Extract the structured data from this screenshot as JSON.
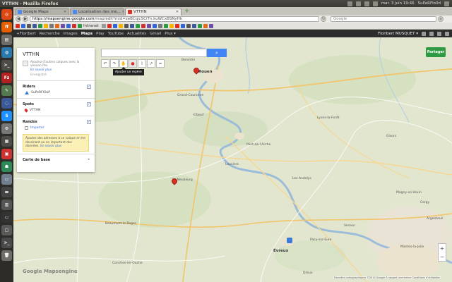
{
  "topbar": {
    "window_title": "VTTHN - Mozilla Firefox",
    "clock": "mar. 3 juin 19:46",
    "user": "SuPeRFlo0d"
  },
  "browser": {
    "tabs": [
      {
        "label": "Google Maps",
        "favicon_color": "#4a8af4",
        "active": false
      },
      {
        "label": "Localisation des me...",
        "favicon_color": "#4a8af4",
        "active": false
      },
      {
        "label": "VTTHN",
        "favicon_color": "#d93025",
        "active": true
      }
    ],
    "new_tab_icon": "+",
    "url_host": "https://mapsengine.google.com",
    "url_rest": "/map/edit?mid=zeBCqjcSCiTn.kuWCxBSNyHk",
    "search_placeholder": "Google"
  },
  "bookmarks": {
    "intranet_label": "Intranet",
    "icon_colors": [
      "#d93025",
      "#3367d6",
      "#5a5a5a",
      "#3b5998",
      "#2e9a44",
      "#f4b400",
      "#777777",
      "#e06c1f",
      "#6d4fa8",
      "#3367d6",
      "#c33",
      "#2e9a44",
      "#999",
      "#d93025",
      "#3367d6",
      "#f4b400",
      "#555",
      "#3b5998",
      "#2e9a44",
      "#c33",
      "#6d4fa8",
      "#3367d6",
      "#777777",
      "#2e9a44",
      "#f4b400",
      "#d93025",
      "#3367d6",
      "#555",
      "#3b5998",
      "#2e9a44",
      "#e06c1f",
      "#6d4fa8"
    ]
  },
  "google_bar": {
    "items": [
      "+Floribert",
      "Recherche",
      "Images",
      "Maps",
      "Play",
      "YouTube",
      "Actualités",
      "Gmail",
      "Plus ▾"
    ],
    "active_index": 3,
    "user_name": "Floribert MUSQUET ▾"
  },
  "panel": {
    "title": "VTTHN",
    "info_text": "Ajoutez d'autres calques avec la version Pro.",
    "info_link": "En savoir plus",
    "saved_text": "Enregistré",
    "layers": [
      {
        "name": "Riders",
        "checked": true,
        "items": [
          {
            "label": "SuPeRFlOoP",
            "marker": "tri"
          }
        ]
      },
      {
        "name": "Spots",
        "checked": true,
        "items": [
          {
            "label": "VTTHN",
            "marker": "pin"
          }
        ]
      },
      {
        "name": "Randos",
        "checked": true,
        "items": [
          {
            "label": "Importer",
            "marker": "import"
          }
        ]
      }
    ],
    "note_text": "Ajouter des adresses à ce calque en les dessinant ou en important des données.",
    "note_link": "En savoir plus",
    "base_layer_label": "Carte de base"
  },
  "map_toolbar": {
    "search_icon": "⌕",
    "buttons": [
      {
        "name": "undo-icon",
        "glyph": "↶"
      },
      {
        "name": "redo-icon",
        "glyph": "↷"
      },
      {
        "name": "hand-icon",
        "glyph": "✋"
      },
      {
        "name": "add-marker-icon",
        "glyph": "●"
      },
      {
        "name": "draw-line-icon",
        "glyph": "⌇"
      },
      {
        "name": "directions-icon",
        "glyph": "↗"
      },
      {
        "name": "ruler-icon",
        "glyph": "━"
      }
    ],
    "tooltip": "Ajouter un repère"
  },
  "share_button": "Partager",
  "zoom": {
    "in": "+",
    "out": "−"
  },
  "map": {
    "logo": "Google Mapsengine",
    "attribution": "Données cartographiques ©2014 Google   À rapport une erreur   Conditions d'utilisation",
    "places": [
      {
        "name": "Rouen",
        "city": true
      },
      {
        "name": "Barentin",
        "city": false
      },
      {
        "name": "Le Neubourg",
        "city": false
      },
      {
        "name": "Évreux",
        "city": true
      },
      {
        "name": "Louviers",
        "city": false
      },
      {
        "name": "Elbeuf",
        "city": false
      },
      {
        "name": "Gisors",
        "city": false
      },
      {
        "name": "Vernon",
        "city": false
      },
      {
        "name": "Les Andelys",
        "city": false
      },
      {
        "name": "Pacy-sur-Eure",
        "city": false
      },
      {
        "name": "Lyons-la-Forêt",
        "city": false
      },
      {
        "name": "Magny-en-Vexin",
        "city": false
      },
      {
        "name": "Beaumont-le-Roger",
        "city": false
      },
      {
        "name": "Conches-en-Ouche",
        "city": false
      },
      {
        "name": "Grand-Couronne",
        "city": false
      },
      {
        "name": "Pont-de-l'Arche",
        "city": false
      },
      {
        "name": "Mantes-la-Jolie",
        "city": false
      },
      {
        "name": "Argenteuil",
        "city": false
      },
      {
        "name": "Cergy",
        "city": false
      },
      {
        "name": "Dreux",
        "city": false
      }
    ]
  }
}
